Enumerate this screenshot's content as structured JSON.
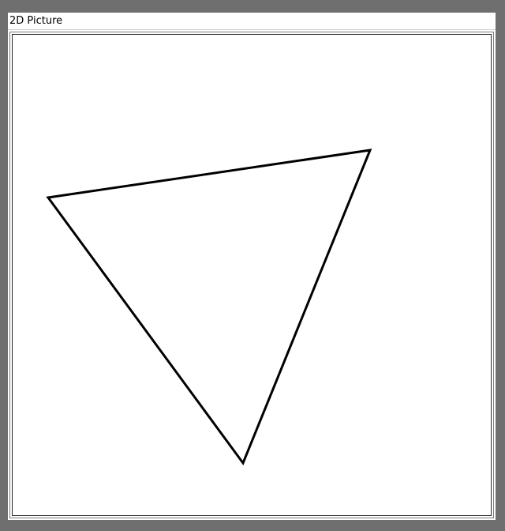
{
  "window": {
    "title": "2D Picture"
  },
  "colors": {
    "background": "#6f6f6f",
    "canvas": "#ffffff",
    "stroke": "#000000"
  },
  "picture": {
    "shape": "triangle"
  }
}
